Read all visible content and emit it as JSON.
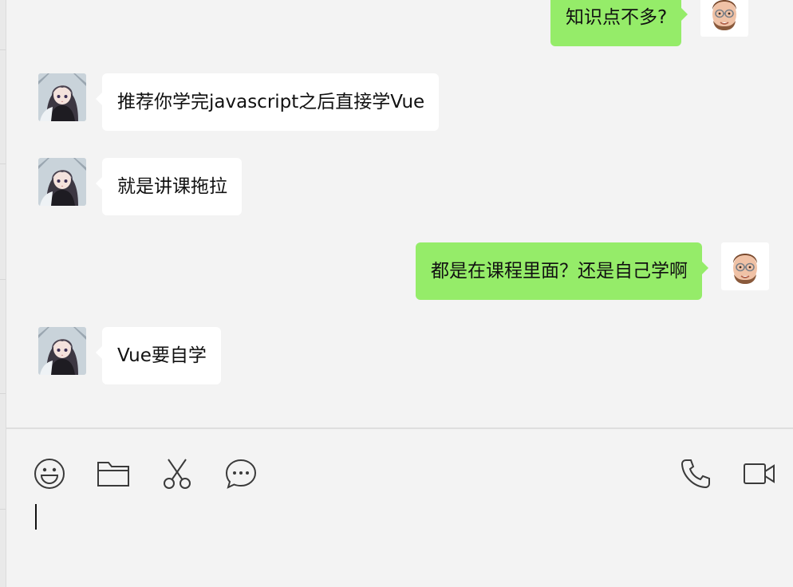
{
  "conversation": {
    "messages": [
      {
        "sender": "self",
        "text": "知识点不多?"
      },
      {
        "sender": "contact",
        "text": "推荐你学完javascript之后直接学Vue"
      },
      {
        "sender": "contact",
        "text": "就是讲课拖拉"
      },
      {
        "sender": "self",
        "text": "都是在课程里面？还是自己学啊"
      },
      {
        "sender": "contact",
        "text": "Vue要自学"
      }
    ]
  },
  "avatars": {
    "contact": "anime-girl-avatar",
    "self": "memoji-man-with-glasses-avatar"
  },
  "toolbar": {
    "left_tools": [
      "emoji-icon",
      "folder-icon",
      "scissors-icon",
      "chat-bubble-icon"
    ],
    "right_tools": [
      "phone-icon",
      "video-camera-icon"
    ]
  },
  "composer": {
    "value": ""
  },
  "colors": {
    "outgoing_bubble": "#95ec69",
    "incoming_bubble": "#ffffff",
    "background": "#f3f3f3",
    "icon_stroke": "#3a3a3a"
  }
}
